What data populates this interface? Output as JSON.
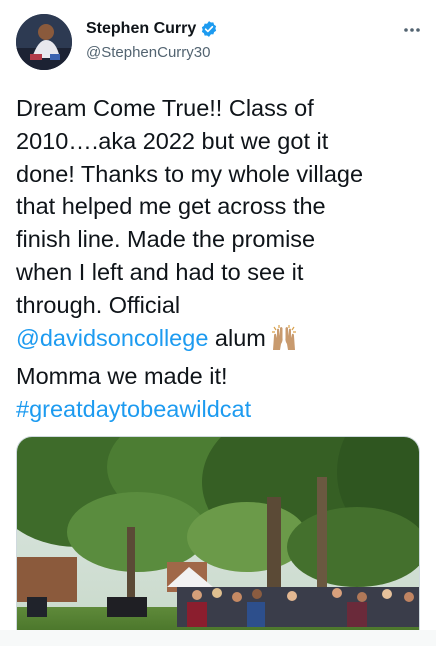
{
  "author": {
    "name": "Stephen Curry",
    "handle": "@StephenCurry30",
    "verified": true,
    "avatar_icon": "profile-avatar"
  },
  "menu": {
    "icon": "more-horizontal-icon"
  },
  "tweet": {
    "lines": [
      "Dream Come True!! Class of",
      "2010….aka 2022 but we got it",
      "done! Thanks to my whole village",
      "that helped me get across the",
      "finish line. Made the promise",
      "when I left and had to see it",
      "through. Official"
    ],
    "mention": "@davidsoncollege",
    "after_mention": " alum",
    "emoji": "raising-hands-emoji",
    "line_after": "Momma we made it!",
    "hashtag": "#greatdaytobeawildcat"
  },
  "media": {
    "description_icon": "photo-campus-graduation"
  },
  "colors": {
    "link": "#1d9bf0",
    "verified": "#1d9bf0",
    "text": "#0f1419",
    "secondary": "#536471"
  }
}
